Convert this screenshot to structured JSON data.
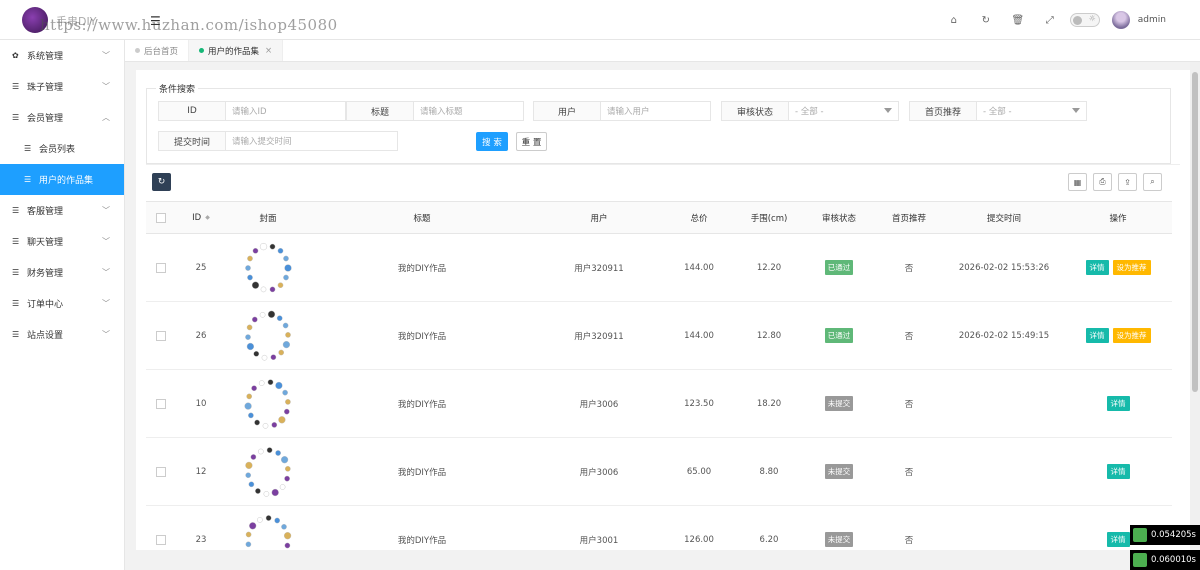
{
  "header": {
    "logo_text": "手串DIY",
    "watermark": "https://www.huzhan.com/ishop45080",
    "menu_toggle": "☰",
    "user_name": "admin",
    "icons": [
      "home-icon",
      "refresh-icon",
      "trash-icon",
      "fullscreen-icon",
      "theme-toggle",
      "avatar"
    ]
  },
  "sidebar": {
    "items": [
      {
        "label": "系统管理",
        "icon": "gear-icon",
        "expanded": false
      },
      {
        "label": "珠子管理",
        "icon": "list-icon",
        "expanded": false
      },
      {
        "label": "会员管理",
        "icon": "list-icon",
        "expanded": true
      },
      {
        "label": "客服管理",
        "icon": "list-icon",
        "expanded": false
      },
      {
        "label": "聊天管理",
        "icon": "list-icon",
        "expanded": false
      },
      {
        "label": "财务管理",
        "icon": "list-icon",
        "expanded": false
      },
      {
        "label": "订单中心",
        "icon": "list-icon",
        "expanded": false
      },
      {
        "label": "站点设置",
        "icon": "list-icon",
        "expanded": false
      }
    ],
    "sub_items": [
      {
        "label": "会员列表",
        "active": false
      },
      {
        "label": "用户的作品集",
        "active": true
      }
    ]
  },
  "tabs": [
    {
      "label": "后台首页",
      "active": false
    },
    {
      "label": "用户的作品集",
      "active": true,
      "close": "×"
    }
  ],
  "search": {
    "legend": "条件搜索",
    "fields": {
      "id": {
        "label": "ID",
        "placeholder": "请输入ID"
      },
      "title": {
        "label": "标题",
        "placeholder": "请输入标题"
      },
      "user": {
        "label": "用户",
        "placeholder": "请输入用户"
      },
      "status": {
        "label": "审核状态",
        "value": "- 全部 -"
      },
      "recommend": {
        "label": "首页推荐",
        "value": "- 全部 -"
      },
      "time": {
        "label": "提交时间",
        "placeholder": "请输入提交时间"
      }
    },
    "search_button": "搜 索",
    "reset_button": "重 置"
  },
  "table": {
    "headers": [
      "ID",
      "封面",
      "标题",
      "用户",
      "总价",
      "手围(cm)",
      "审核状态",
      "首页推荐",
      "提交时间",
      "操作"
    ],
    "rows": [
      {
        "id": "25",
        "title": "我的DIY作品",
        "user": "用户320911",
        "price": "144.00",
        "wrist": "12.20",
        "status": "已通过",
        "status_type": "ok",
        "recommend": "否",
        "time": "2026-02-02 15:53:26",
        "ops": [
          "详情",
          "设为推荐"
        ]
      },
      {
        "id": "26",
        "title": "我的DIY作品",
        "user": "用户320911",
        "price": "144.00",
        "wrist": "12.80",
        "status": "已通过",
        "status_type": "ok",
        "recommend": "否",
        "time": "2026-02-02 15:49:15",
        "ops": [
          "详情",
          "设为推荐"
        ]
      },
      {
        "id": "10",
        "title": "我的DIY作品",
        "user": "用户3006",
        "price": "123.50",
        "wrist": "18.20",
        "status": "未提交",
        "status_type": "pend",
        "recommend": "否",
        "time": "",
        "ops": [
          "详情"
        ]
      },
      {
        "id": "12",
        "title": "我的DIY作品",
        "user": "用户3006",
        "price": "65.00",
        "wrist": "8.80",
        "status": "未提交",
        "status_type": "pend",
        "recommend": "否",
        "time": "",
        "ops": [
          "详情"
        ]
      },
      {
        "id": "23",
        "title": "我的DIY作品",
        "user": "用户3001",
        "price": "126.00",
        "wrist": "6.20",
        "status": "未提交",
        "status_type": "pend",
        "recommend": "否",
        "time": "",
        "ops": [
          "详情"
        ]
      }
    ]
  },
  "timers": [
    "0.054205s",
    "0.060010s"
  ],
  "colors": {
    "primary": "#1e9fff",
    "approved": "#5fb878",
    "pending": "#999999",
    "detail": "#16baaa",
    "recommend": "#ffb800",
    "dark_btn": "#2f4056"
  }
}
